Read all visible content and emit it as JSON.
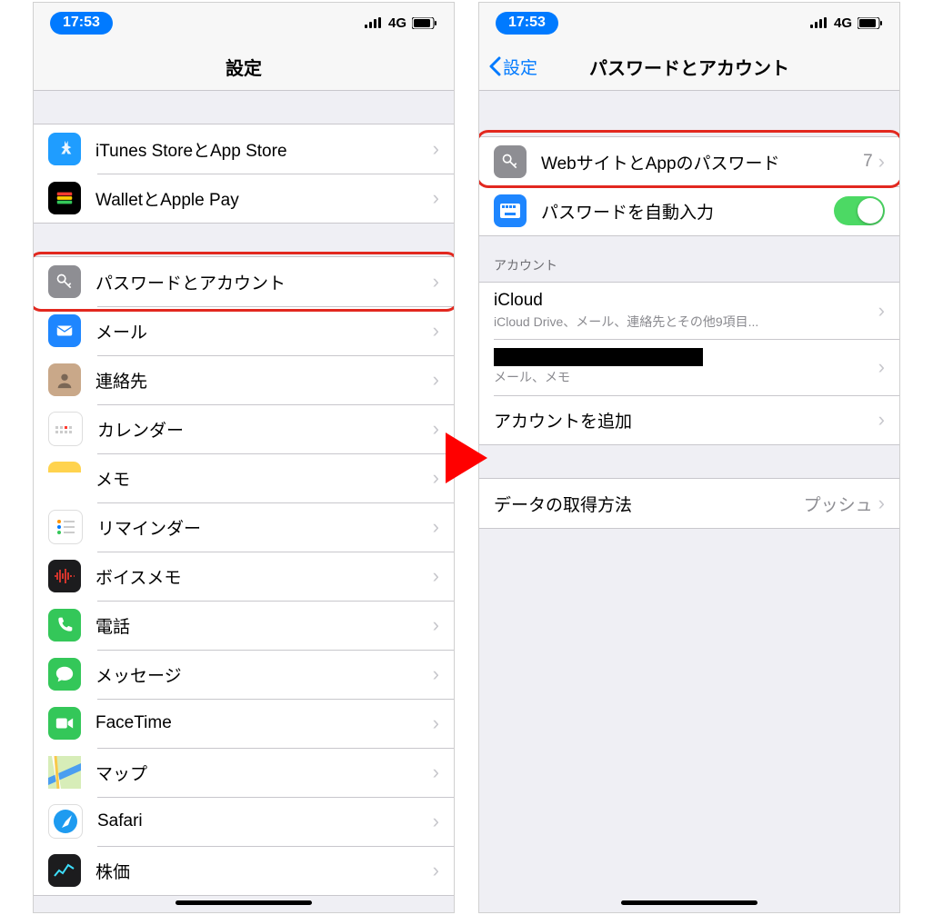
{
  "status": {
    "time": "17:53",
    "network": "4G"
  },
  "left": {
    "title": "設定",
    "group1": [
      {
        "label": "iTunes StoreとApp Store",
        "icon": "appstore-icon"
      },
      {
        "label": "WalletとApple Pay",
        "icon": "wallet-icon"
      }
    ],
    "group2": [
      {
        "label": "パスワードとアカウント",
        "icon": "key-icon",
        "highlight": true
      },
      {
        "label": "メール",
        "icon": "mail-icon"
      },
      {
        "label": "連絡先",
        "icon": "contacts-icon"
      },
      {
        "label": "カレンダー",
        "icon": "calendar-icon"
      },
      {
        "label": "メモ",
        "icon": "notes-icon"
      },
      {
        "label": "リマインダー",
        "icon": "reminders-icon"
      },
      {
        "label": "ボイスメモ",
        "icon": "voicememo-icon"
      },
      {
        "label": "電話",
        "icon": "phone-icon"
      },
      {
        "label": "メッセージ",
        "icon": "messages-icon"
      },
      {
        "label": "FaceTime",
        "icon": "facetime-icon"
      },
      {
        "label": "マップ",
        "icon": "maps-icon"
      },
      {
        "label": "Safari",
        "icon": "safari-icon"
      },
      {
        "label": "株価",
        "icon": "stocks-icon"
      }
    ]
  },
  "right": {
    "back": "設定",
    "title": "パスワードとアカウント",
    "passwords": {
      "websitePasswords": {
        "label": "WebサイトとAppのパスワード",
        "count": "7",
        "highlight": true
      },
      "autofill": {
        "label": "パスワードを自動入力",
        "on": true
      }
    },
    "accountsHeader": "アカウント",
    "accounts": {
      "icloud": {
        "title": "iCloud",
        "sub": "iCloud Drive、メール、連絡先とその他9項目..."
      },
      "hidden": {
        "sub": "メール、メモ"
      },
      "add": {
        "label": "アカウントを追加"
      }
    },
    "fetch": {
      "label": "データの取得方法",
      "value": "プッシュ"
    }
  }
}
